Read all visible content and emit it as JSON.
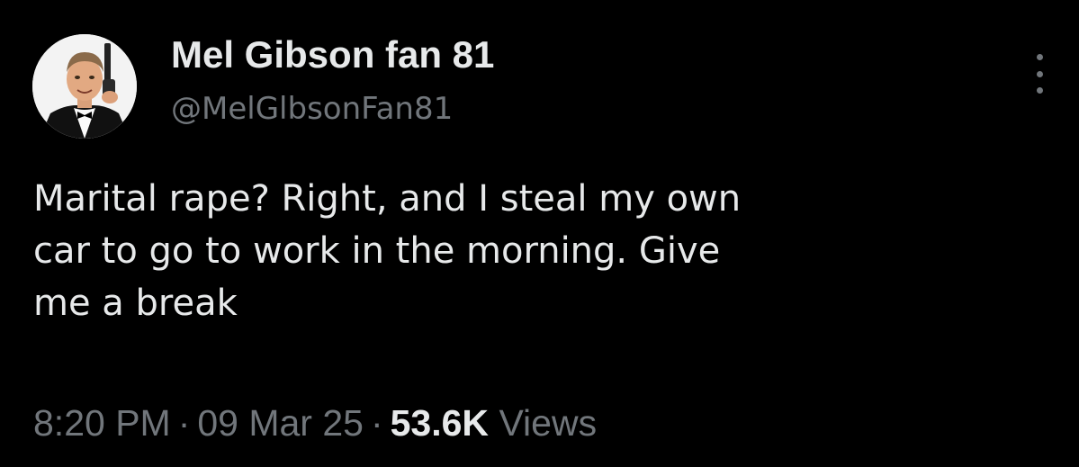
{
  "tweet": {
    "display_name": "Mel Gibson fan 81",
    "handle": "@MelGlbsonFan81",
    "text": "Marital rape? Right, and I steal my own\ncar to go to work in the morning. Give\nme a break",
    "time": "8:20 PM",
    "separator": "·",
    "date": "09 Mar 25",
    "views_count": "53.6K",
    "views_label": "Views"
  },
  "icons": {
    "more": "more-horizontal-icon",
    "avatar": "profile-avatar"
  },
  "colors": {
    "background": "#000000",
    "primary_text": "#e7e9ea",
    "secondary_text": "#71767b"
  }
}
